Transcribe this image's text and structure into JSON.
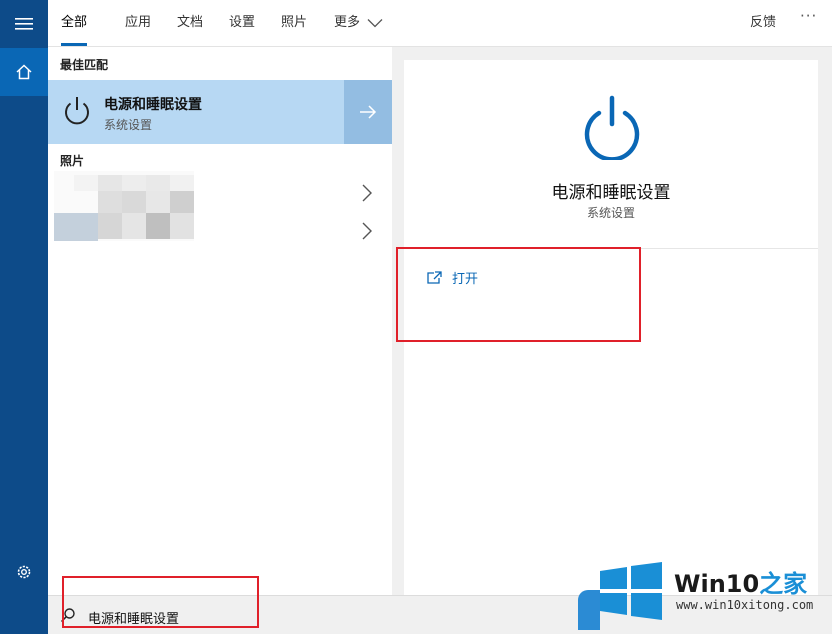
{
  "nav_tabs": [
    "全部",
    "应用",
    "文档",
    "设置",
    "照片",
    "更多"
  ],
  "active_tab": "全部",
  "feedback_label": "反馈",
  "more_dots": "···",
  "best_match": {
    "section_label": "最佳匹配",
    "title": "电源和睡眠设置",
    "subtitle": "系统设置"
  },
  "photos": {
    "section_label": "照片"
  },
  "details": {
    "title": "电源和睡眠设置",
    "subtitle": "系统设置",
    "open_label": "打开"
  },
  "search": {
    "query": "电源和睡眠设置"
  },
  "watermark": {
    "brand_prefix": "Win10",
    "brand_suffix": "之家",
    "url": "www.win10xitong.com"
  },
  "icons": {
    "menu": "hamburger-icon",
    "home": "home-icon",
    "settings": "gear-icon",
    "power": "power-icon",
    "arrow": "arrow-right-icon",
    "chevron": "chevron-right-icon",
    "open": "open-external-icon",
    "search": "search-icon"
  },
  "colors": {
    "accent": "#0a67b5",
    "rail": "#0d4b89",
    "selection": "#b7d8f3",
    "highlight_box": "#e0202a"
  }
}
